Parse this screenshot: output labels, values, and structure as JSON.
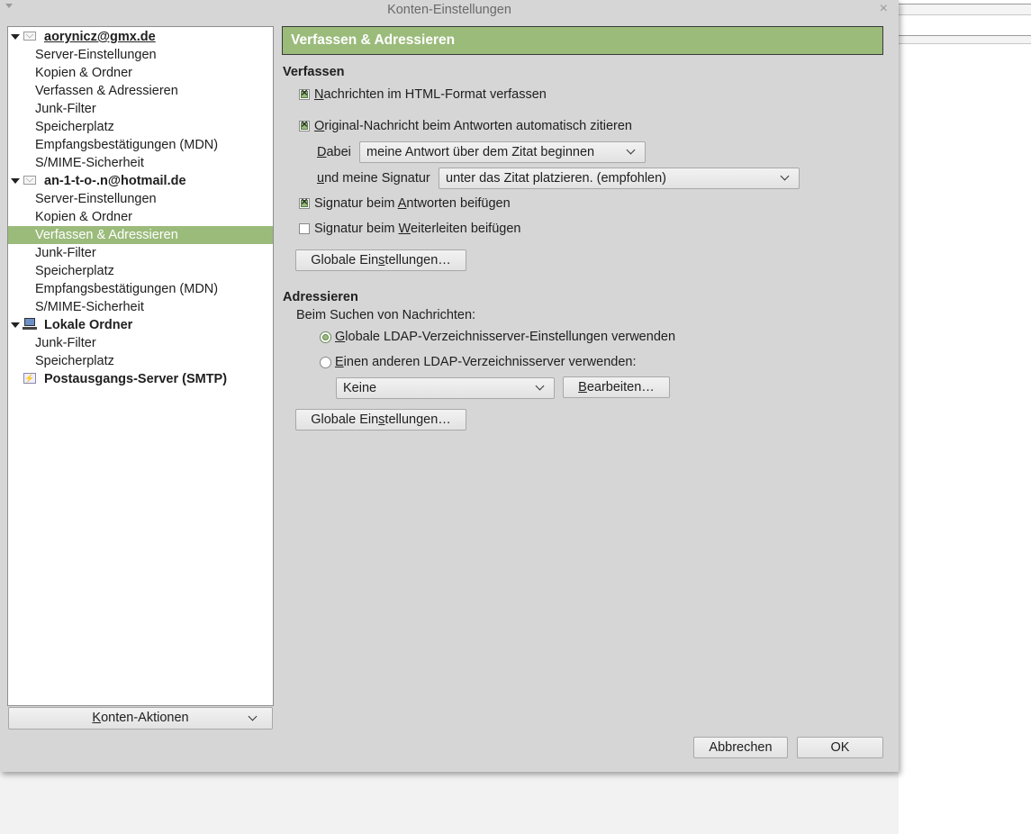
{
  "window": {
    "title": "Konten-Einstellungen",
    "close": "×"
  },
  "tree": {
    "items": [
      {
        "label": "aorynicz@gmx.de",
        "type": "account"
      },
      {
        "label": "Server-Einstellungen"
      },
      {
        "label": "Kopien & Ordner"
      },
      {
        "label": "Verfassen & Adressieren"
      },
      {
        "label": "Junk-Filter"
      },
      {
        "label": "Speicherplatz"
      },
      {
        "label": "Empfangsbestätigungen (MDN)"
      },
      {
        "label": "S/MIME-Sicherheit"
      },
      {
        "label": "an-1-t-o-.n@hotmail.de",
        "type": "account"
      },
      {
        "label": "Server-Einstellungen"
      },
      {
        "label": "Kopien & Ordner"
      },
      {
        "label": "Verfassen & Adressieren",
        "selected": true
      },
      {
        "label": "Junk-Filter"
      },
      {
        "label": "Speicherplatz"
      },
      {
        "label": "Empfangsbestätigungen (MDN)"
      },
      {
        "label": "S/MIME-Sicherheit"
      },
      {
        "label": "Lokale Ordner",
        "type": "account"
      },
      {
        "label": "Junk-Filter"
      },
      {
        "label": "Speicherplatz"
      },
      {
        "label": "Postausgangs-Server (SMTP)",
        "type": "account"
      }
    ],
    "actions_button": {
      "access": "K",
      "rest": "onten-Aktionen"
    }
  },
  "panel": {
    "title": "Verfassen & Adressieren",
    "compose": {
      "heading": "Verfassen",
      "html_format": {
        "access": "N",
        "rest": "achrichten im HTML-Format verfassen",
        "checked": true
      },
      "quote_original": {
        "access": "O",
        "rest": "riginal-Nachricht beim Antworten automatisch zitieren",
        "checked": true
      },
      "then_label": {
        "access": "D",
        "rest": "abei"
      },
      "then_value": "meine Antwort über dem Zitat beginnen",
      "signature_label": {
        "access": "u",
        "rest": "nd meine Signatur"
      },
      "signature_value": "unter das Zitat platzieren. (empfohlen)",
      "sig_reply": {
        "pre": "Signatur beim ",
        "access": "A",
        "rest": "ntworten beifügen",
        "checked": true
      },
      "sig_forward": {
        "pre": "Signatur beim ",
        "access": "W",
        "rest": "eiterleiten beifügen",
        "checked": false
      },
      "global_button": {
        "pre": "Globale Ein",
        "access": "s",
        "rest": "tellungen…"
      }
    },
    "addressing": {
      "heading": "Adressieren",
      "search_label": "Beim Suchen von Nachrichten:",
      "use_global": {
        "access": "G",
        "rest": "lobale LDAP-Verzeichnisserver-Einstellungen verwenden",
        "selected": true
      },
      "use_other": {
        "access": "E",
        "rest": "inen anderen LDAP-Verzeichnisserver verwenden:",
        "selected": false
      },
      "directory_value": "Keine",
      "edit_button": {
        "access": "B",
        "rest": "earbeiten…"
      },
      "global_button": {
        "pre": "Globale Ein",
        "access": "s",
        "rest": "tellungen…"
      }
    }
  },
  "footer": {
    "cancel": "Abbrechen",
    "ok": "OK"
  },
  "colors": {
    "accent": "#9bbb7b",
    "dialog_bg": "#d6d6d6"
  }
}
